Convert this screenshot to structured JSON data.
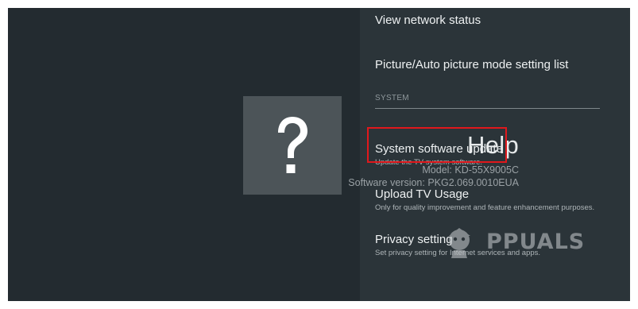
{
  "help_panel": {
    "title": "Help",
    "model": "Model: KD-55X9005C",
    "software_version": "Software version: PKG2.069.0010EUA",
    "icon": "question-mark-icon"
  },
  "menu": {
    "items": [
      {
        "title": "View network status",
        "subtitle": ""
      },
      {
        "title": "Picture/Auto picture mode setting list",
        "subtitle": ""
      }
    ],
    "section_label": "SYSTEM",
    "system_items": [
      {
        "title": "System software update",
        "subtitle": "Update the TV system software."
      },
      {
        "title": "Upload TV Usage",
        "subtitle": "Only for quality improvement and feature enhancement purposes."
      },
      {
        "title": "Privacy setting",
        "subtitle": "Set privacy setting for Internet services and apps."
      }
    ]
  },
  "annotation": {
    "highlight_color": "#e0181c"
  },
  "watermark": {
    "text": "PPUALS"
  }
}
